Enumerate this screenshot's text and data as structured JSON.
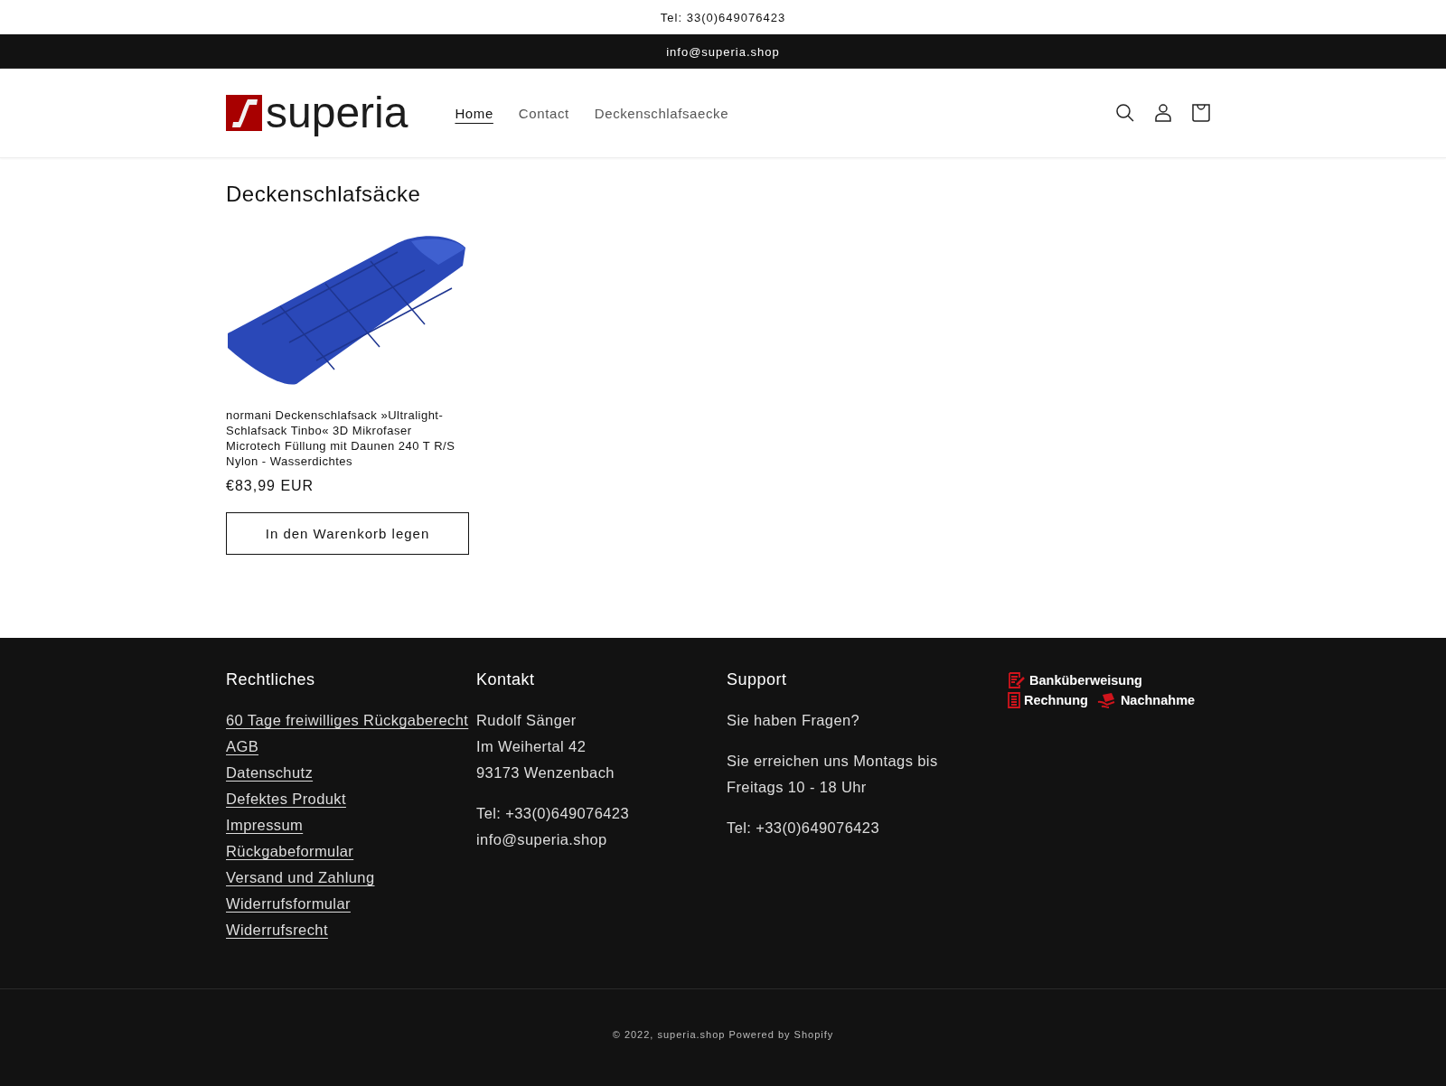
{
  "announcements": [
    "Tel: 33(0)649076423",
    "info@superia.shop"
  ],
  "header": {
    "logo": "superia",
    "nav": [
      {
        "label": "Home",
        "selected": true
      },
      {
        "label": "Contact",
        "selected": false
      },
      {
        "label": "Deckenschlafsaecke",
        "selected": false
      }
    ]
  },
  "collection": {
    "title": "Deckenschlafsäcke",
    "products": [
      {
        "title": "normani Deckenschlafsack »Ultralight-Schlafsack Tinbo« 3D Mikrofaser Microtech Füllung mit Daunen 240 T R/S Nylon - Wasserdichtes",
        "price": "€83,99 EUR",
        "button": "In den Warenkorb legen"
      }
    ]
  },
  "footer": {
    "columns": [
      {
        "kind": "links",
        "heading": "Rechtliches",
        "links": [
          "60 Tage freiwilliges Rückgaberecht",
          "AGB",
          "Datenschutz",
          "Defektes Produkt",
          "Impressum",
          "Rückgabeformular",
          "Versand und Zahlung",
          "Widerrufsformular",
          "Widerrufsrecht"
        ]
      },
      {
        "kind": "text",
        "heading": "Kontakt",
        "paragraphs": [
          [
            "Rudolf Sänger",
            "Im Weihertal 42",
            "93173 Wenzenbach"
          ],
          [
            "Tel: +33(0)649076423",
            "info@superia.shop"
          ]
        ]
      },
      {
        "kind": "text",
        "heading": "Support",
        "paragraphs": [
          [
            "Sie haben Fragen?"
          ],
          [
            "Sie erreichen uns Montags bis",
            "Freitags 10 - 18 Uhr"
          ],
          [
            "Tel: +33(0)649076423"
          ]
        ]
      },
      {
        "kind": "payments",
        "methods": [
          [
            "Banküberweisung"
          ],
          [
            "Rechnung",
            "Nachnahme"
          ]
        ]
      }
    ],
    "copyright": "© 2022,",
    "site_link": "superia.shop",
    "powered": "Powered by Shopify"
  }
}
